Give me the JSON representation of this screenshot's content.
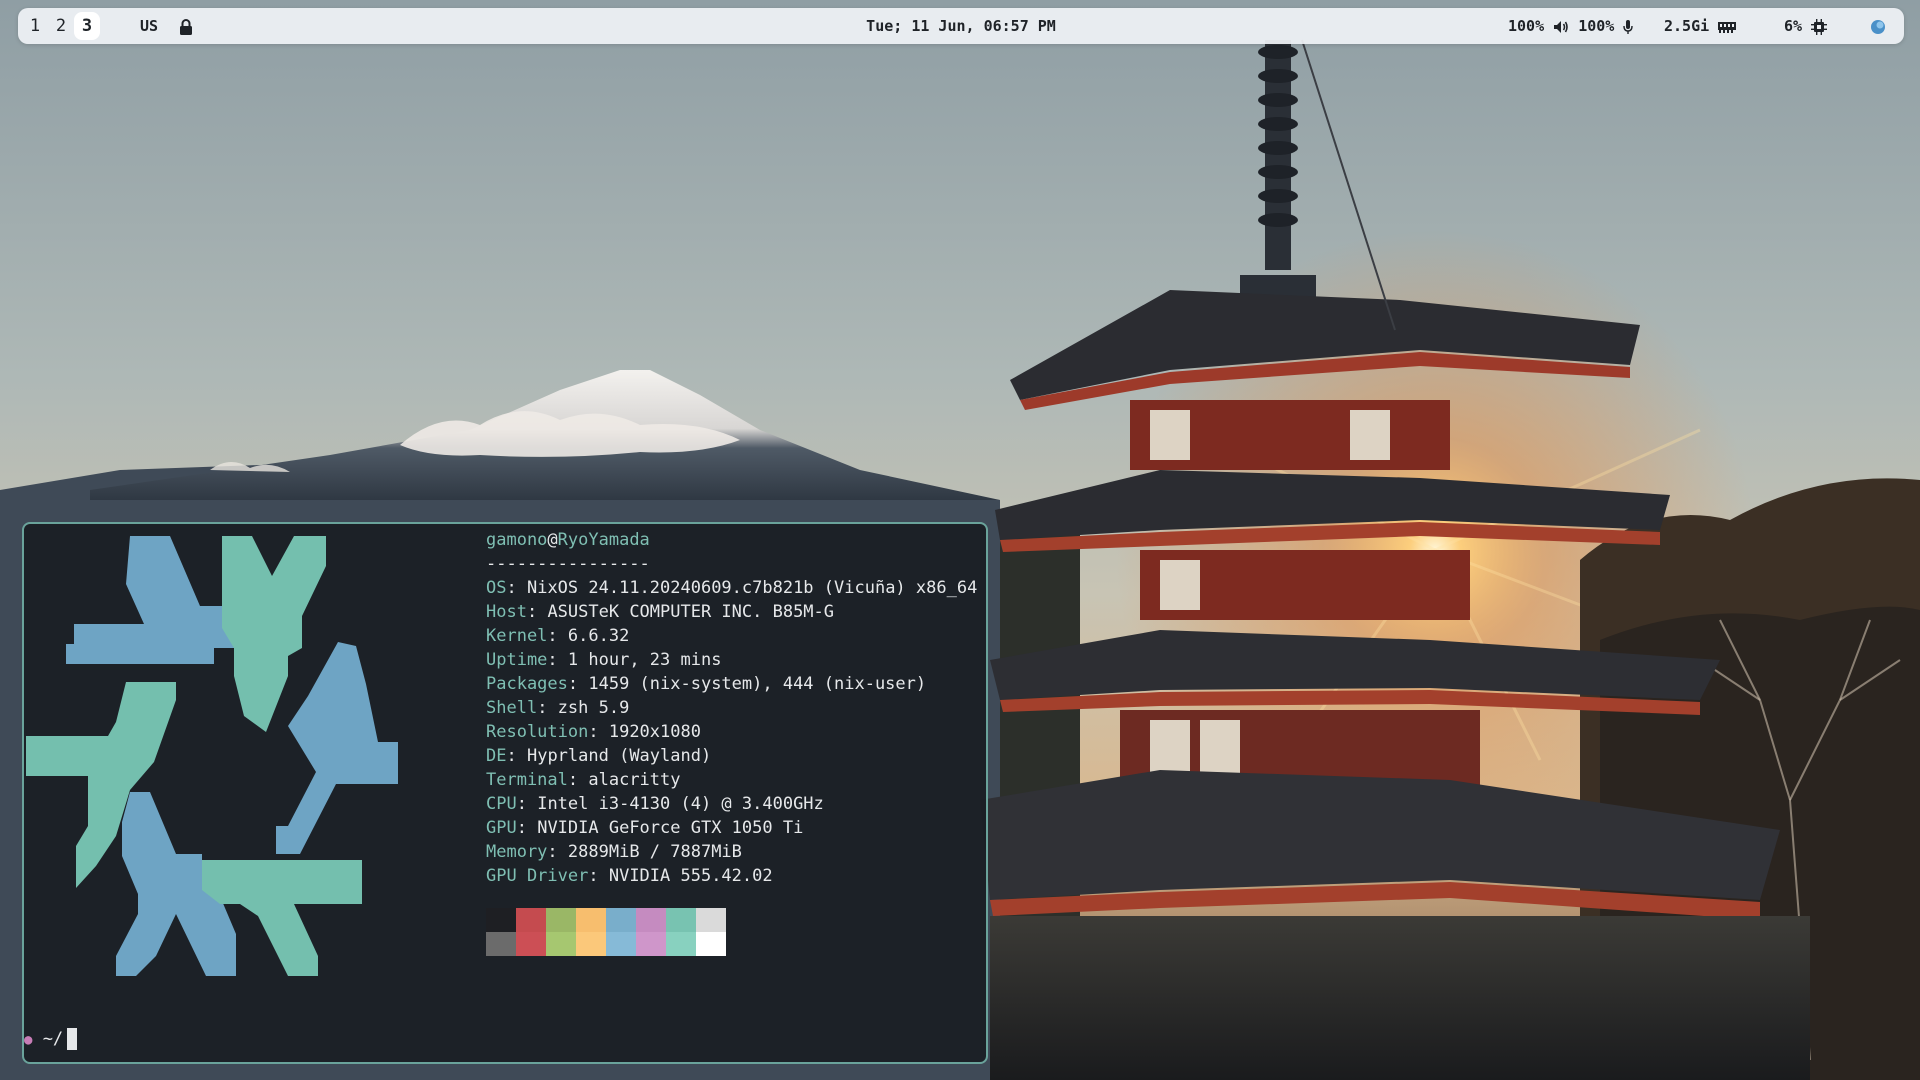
{
  "topbar": {
    "workspaces": [
      {
        "label": "1",
        "active": false
      },
      {
        "label": "2",
        "active": false
      },
      {
        "label": "3",
        "active": true
      }
    ],
    "keyboard_layout": "US",
    "clock": "Tue; 11 Jun, 06:57 PM",
    "volume": "100%",
    "microphone": "100%",
    "memory": "2.5Gi",
    "cpu": "6%"
  },
  "terminal": {
    "user": "gamono",
    "at": "@",
    "host": "RyoYamada",
    "separator": "----------------",
    "info": [
      {
        "key": "OS",
        "value": "NixOS 24.11.20240609.c7b821b (Vicuña) x86_64"
      },
      {
        "key": "Host",
        "value": "ASUSTeK COMPUTER INC. B85M-G"
      },
      {
        "key": "Kernel",
        "value": "6.6.32"
      },
      {
        "key": "Uptime",
        "value": "1 hour, 23 mins"
      },
      {
        "key": "Packages",
        "value": "1459 (nix-system), 444 (nix-user)"
      },
      {
        "key": "Shell",
        "value": "zsh 5.9"
      },
      {
        "key": "Resolution",
        "value": "1920x1080"
      },
      {
        "key": "DE",
        "value": "Hyprland (Wayland)"
      },
      {
        "key": "Terminal",
        "value": "alacritty"
      },
      {
        "key": "CPU",
        "value": "Intel i3-4130 (4) @ 3.400GHz"
      },
      {
        "key": "GPU",
        "value": "NVIDIA GeForce GTX 1050 Ti"
      },
      {
        "key": "Memory",
        "value": "2889MiB / 7887MiB"
      },
      {
        "key": "GPU Driver",
        "value": "NVIDIA 555.42.02"
      }
    ],
    "palette_top": [
      "#1e1f23",
      "#c54b4f",
      "#9ab766",
      "#f7be6e",
      "#79aecb",
      "#c58bc0",
      "#78c3b1",
      "#dadada"
    ],
    "palette_bottom": [
      "#6b6b6b",
      "#cc4f55",
      "#a6c770",
      "#fbc87a",
      "#86bad7",
      "#cf96ca",
      "#88d1bf",
      "#ffffff"
    ],
    "logo_colors": {
      "blue": "#6ea4c4",
      "teal": "#74bfae"
    },
    "prompt_path": "~/",
    "prompt_icon": "apple-icon"
  }
}
